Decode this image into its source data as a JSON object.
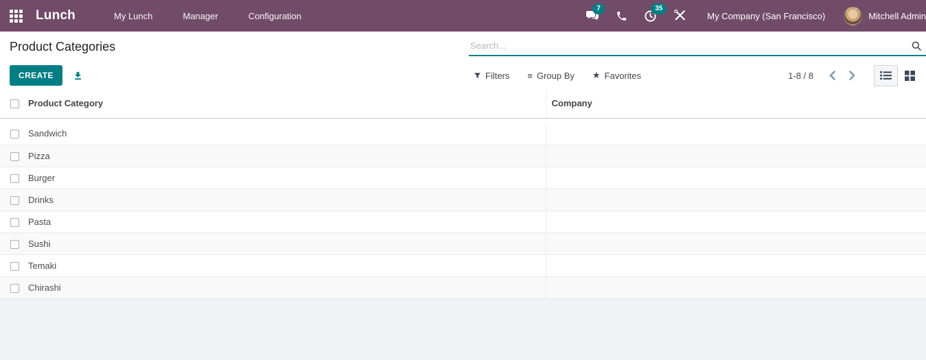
{
  "topbar": {
    "app_name": "Lunch",
    "menus": [
      {
        "label": "My Lunch"
      },
      {
        "label": "Manager"
      },
      {
        "label": "Configuration"
      }
    ],
    "messages_badge": "7",
    "activities_badge": "35",
    "company": "My Company (San Francisco)",
    "user": "Mitchell Admin"
  },
  "breadcrumb": {
    "title": "Product Categories"
  },
  "search": {
    "placeholder": "Search..."
  },
  "control_panel": {
    "create_label": "CREATE",
    "filters_label": "Filters",
    "group_by_label": "Group By",
    "favorites_label": "Favorites",
    "pager_value": "1-8 / 8"
  },
  "table": {
    "columns": [
      "Product Category",
      "Company"
    ],
    "rows": [
      {
        "category": "Sandwich",
        "company": ""
      },
      {
        "category": "Pizza",
        "company": ""
      },
      {
        "category": "Burger",
        "company": ""
      },
      {
        "category": "Drinks",
        "company": ""
      },
      {
        "category": "Pasta",
        "company": ""
      },
      {
        "category": "Sushi",
        "company": ""
      },
      {
        "category": "Temaki",
        "company": ""
      },
      {
        "category": "Chirashi",
        "company": ""
      }
    ]
  },
  "colors": {
    "topbar_bg": "#714B67",
    "accent_teal": "#017E84",
    "icon_slate": "#3c4858",
    "chevron_blue": "#7c9ab0"
  }
}
